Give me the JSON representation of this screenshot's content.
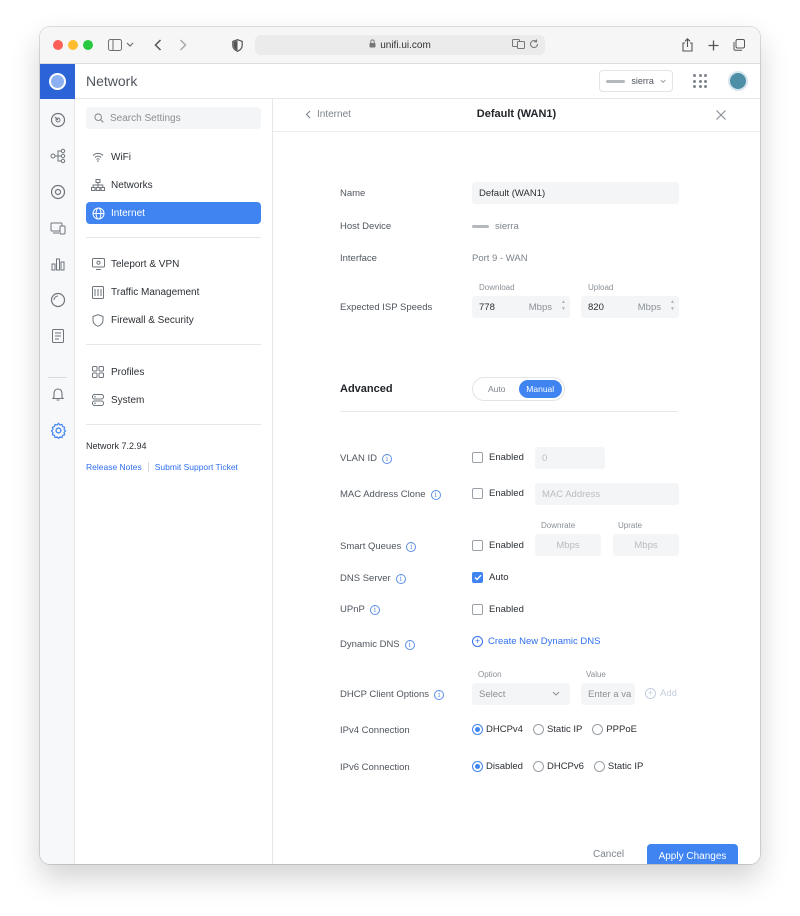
{
  "browser": {
    "url": "unifi.ui.com"
  },
  "app": {
    "title": "Network",
    "device_name": "sierra"
  },
  "search": {
    "placeholder": "Search Settings"
  },
  "sidebar": {
    "items": [
      {
        "label": "WiFi",
        "icon": "wifi-icon"
      },
      {
        "label": "Networks",
        "icon": "networks-icon"
      },
      {
        "label": "Internet",
        "icon": "globe-icon",
        "active": true
      },
      {
        "label": "Teleport & VPN",
        "icon": "teleport-icon"
      },
      {
        "label": "Traffic Management",
        "icon": "traffic-icon"
      },
      {
        "label": "Firewall & Security",
        "icon": "shield-icon"
      },
      {
        "label": "Profiles",
        "icon": "profiles-icon"
      },
      {
        "label": "System",
        "icon": "system-icon"
      }
    ],
    "version": "Network 7.2.94",
    "release_notes": "Release Notes",
    "support_ticket": "Submit Support Ticket"
  },
  "panel": {
    "back_label": "Internet",
    "title": "Default (WAN1)"
  },
  "form": {
    "name_label": "Name",
    "name_value": "Default (WAN1)",
    "host_label": "Host Device",
    "host_value": "sierra",
    "interface_label": "Interface",
    "interface_value": "Port 9 - WAN",
    "isp_label": "Expected ISP Speeds",
    "download_label": "Download",
    "download_value": "778",
    "upload_label": "Upload",
    "upload_value": "820",
    "unit": "Mbps"
  },
  "advanced": {
    "title": "Advanced",
    "auto": "Auto",
    "manual": "Manual",
    "mode": "Manual",
    "vlan_label": "VLAN ID",
    "vlan_check": "Enabled",
    "vlan_value": "0",
    "mac_label": "MAC Address Clone",
    "mac_check": "Enabled",
    "mac_placeholder": "MAC Address",
    "sq_label": "Smart Queues",
    "sq_check": "Enabled",
    "downrate_label": "Downrate",
    "uprate_label": "Uprate",
    "sq_unit": "Mbps",
    "dns_label": "DNS Server",
    "dns_check": "Auto",
    "upnp_label": "UPnP",
    "upnp_check": "Enabled",
    "ddns_label": "Dynamic DNS",
    "ddns_link": "Create New Dynamic DNS",
    "dhcp_label": "DHCP Client Options",
    "option_label": "Option",
    "value_label": "Value",
    "option_select": "Select",
    "value_placeholder": "Enter a va",
    "add_label": "Add",
    "ipv4_label": "IPv4 Connection",
    "ipv4_options": [
      "DHCPv4",
      "Static IP",
      "PPPoE"
    ],
    "ipv4_selected": "DHCPv4",
    "ipv6_label": "IPv6 Connection",
    "ipv6_options": [
      "Disabled",
      "DHCPv6",
      "Static IP"
    ],
    "ipv6_selected": "Disabled"
  },
  "actions": {
    "cancel": "Cancel",
    "apply": "Apply Changes"
  },
  "colors": {
    "accent": "#3f84f1",
    "brand": "#2c64d8",
    "link": "#2f6ff0"
  }
}
